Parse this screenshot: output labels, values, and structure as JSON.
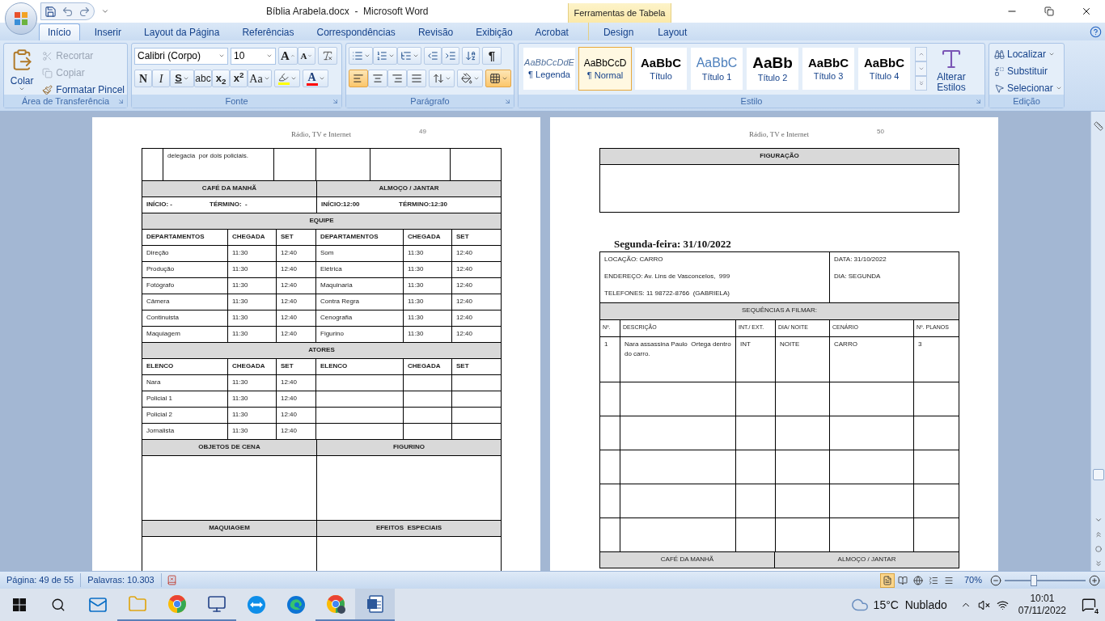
{
  "title_bar": {
    "title": "Bíblia Arabela.docx  -  Microsoft Word",
    "contextual_group": "Ferramentas de Tabela"
  },
  "quick_access": [
    {
      "kind": "save"
    },
    {
      "kind": "undo"
    },
    {
      "kind": "redo"
    },
    {
      "kind": "customize"
    }
  ],
  "tabs": [
    {
      "label": "Início",
      "selected": true
    },
    {
      "label": "Inserir",
      "selected": false
    },
    {
      "label": "Layout da Página",
      "selected": false
    },
    {
      "label": "Referências",
      "selected": false
    },
    {
      "label": "Correspondências",
      "selected": false
    },
    {
      "label": "Revisão",
      "selected": false
    },
    {
      "label": "Exibição",
      "selected": false
    },
    {
      "label": "Acrobat",
      "selected": false
    }
  ],
  "contextual_tabs": [
    {
      "label": "Design",
      "selected": false
    },
    {
      "label": "Layout",
      "selected": false
    }
  ],
  "ribbon": {
    "clipboard": {
      "label": "Área de Transferência",
      "paste": "Colar",
      "items": [
        {
          "kind": "cut",
          "label": "Recortar",
          "disabled": true
        },
        {
          "kind": "copy",
          "label": "Copiar",
          "disabled": true
        },
        {
          "kind": "painter",
          "label": "Formatar Pincel",
          "disabled": false
        }
      ]
    },
    "font": {
      "label": "Fonte",
      "font_name": "Calibri (Corpo)",
      "font_size": "10",
      "grow_font": "A",
      "shrink_font": "A",
      "format_buttons": [
        {
          "kind": "bold",
          "label": "N",
          "dropdown": false
        },
        {
          "kind": "italic",
          "label": "I",
          "dropdown": false
        },
        {
          "kind": "underline",
          "label": "S",
          "dropdown": true
        },
        {
          "kind": "strike",
          "label": "abc",
          "dropdown": false
        },
        {
          "kind": "subscript",
          "label": "x$_{2}$",
          "dropdown": false
        },
        {
          "kind": "superscript",
          "label": "x$^{2}$",
          "dropdown": false
        },
        {
          "kind": "case",
          "label": "Aa",
          "dropdown": true
        }
      ],
      "font_color": "A"
    },
    "paragraph": {
      "label": "Parágrafo",
      "show_marks": "¶",
      "alignments": [
        {
          "kind": "left",
          "selected": true
        },
        {
          "kind": "center",
          "selected": false
        },
        {
          "kind": "right",
          "selected": false
        },
        {
          "kind": "justify",
          "selected": false
        }
      ],
      "fill_buttons": [
        {
          "kind": "line_spacing",
          "selected": false
        },
        {
          "kind": "shading",
          "selected": false
        },
        {
          "kind": "borders",
          "selected": true
        }
      ]
    },
    "styles": {
      "label": "Estilo",
      "change_styles": "Alterar Estilos",
      "items": [
        {
          "kind": "caption",
          "preview": "AaBbCcDdE",
          "name": "¶ Legenda",
          "selected": false
        },
        {
          "kind": "normal",
          "preview": "AaBbCcD",
          "name": "¶ Normal",
          "selected": true
        },
        {
          "kind": "title",
          "preview": "AaBbC",
          "name": "Título",
          "selected": false
        },
        {
          "kind": "heading1",
          "preview": "AaBbC",
          "name": "Título 1",
          "selected": false
        },
        {
          "kind": "heading2",
          "preview": "AaBb",
          "name": "Título 2",
          "selected": false
        },
        {
          "kind": "heading3",
          "preview": "AaBbC",
          "name": "Título 3",
          "selected": false
        },
        {
          "kind": "heading4",
          "preview": "AaBbC",
          "name": "Título 4",
          "selected": false
        }
      ]
    },
    "editing": {
      "label": "Edição",
      "items": [
        {
          "kind": "find",
          "label": "Localizar",
          "dropdown": true
        },
        {
          "kind": "replace",
          "label": "Substituir",
          "dropdown": false
        },
        {
          "kind": "select",
          "label": "Selecionar",
          "dropdown": true
        }
      ]
    }
  },
  "pages": [
    {
      "header": "Rádio, TV e Internet",
      "number": "49",
      "blocks": [
        {
          "kind": "table",
          "rows": [
            {
              "kind": "continuation",
              "cells": [
                "delegacia  por dois policiais."
              ]
            },
            {
              "kind": "pair_head",
              "cells": [
                "CAFÉ DA MANHÃ",
                "ALMOÇO / JANTAR"
              ]
            },
            {
              "kind": "times",
              "cells": [
                {
                  "start": "INÍCIO: -",
                  "end": "TÉRMINO:  -"
                },
                {
                  "start": "INÍCIO:12:00",
                  "end": "TÉRMINO:12:30"
                }
              ]
            },
            {
              "kind": "band",
              "cells": [
                "EQUIPE"
              ]
            },
            {
              "kind": "crew_head",
              "cells": [
                "DEPARTAMENTOS",
                "CHEGADA",
                "SET",
                "DEPARTAMENTOS",
                "CHEGADA",
                "SET"
              ]
            },
            {
              "kind": "crew",
              "cells": [
                "Direção",
                "11:30",
                "12:40",
                "Som",
                "11:30",
                "12:40"
              ]
            },
            {
              "kind": "crew",
              "cells": [
                "Produção",
                "11:30",
                "12:40",
                "Elétrica",
                "11:30",
                "12:40"
              ]
            },
            {
              "kind": "crew",
              "cells": [
                "Fotógrafo",
                "11:30",
                "12:40",
                "Maquinaria",
                "11:30",
                "12:40"
              ]
            },
            {
              "kind": "crew",
              "cells": [
                "Câmera",
                "11:30",
                "12:40",
                "Contra Regra",
                "11:30",
                "12:40"
              ]
            },
            {
              "kind": "crew",
              "cells": [
                "Continuista",
                "11:30",
                "12:40",
                "Cenografia",
                "11:30",
                "12:40"
              ]
            },
            {
              "kind": "crew",
              "cells": [
                "Maquiagem",
                "11:30",
                "12:40",
                "Figurino",
                "11:30",
                "12:40"
              ]
            },
            {
              "kind": "band",
              "cells": [
                "ATORES"
              ]
            },
            {
              "kind": "crew_head",
              "cells": [
                "ELENCO",
                "CHEGADA",
                "SET",
                "ELENCO",
                "CHEGADA",
                "SET"
              ]
            },
            {
              "kind": "crew",
              "cells": [
                "Nara",
                "11:30",
                "12:40"
              ]
            },
            {
              "kind": "crew",
              "cells": [
                "Policial 1",
                "11:30",
                "12:40"
              ]
            },
            {
              "kind": "crew",
              "cells": [
                "Policial 2",
                "11:30",
                "12:40"
              ]
            },
            {
              "kind": "crew",
              "cells": [
                "Jornalista",
                "11:30",
                "12:40"
              ]
            },
            {
              "kind": "pair_head",
              "cells": [
                "OBJETOS DE CENA",
                "FIGURINO"
              ]
            },
            {
              "kind": "pair_box"
            },
            {
              "kind": "pair_head",
              "cells": [
                "MAQUIAGEM",
                "EFEITOS  ESPECIAIS"
              ]
            },
            {
              "kind": "pair_box"
            }
          ]
        }
      ]
    },
    {
      "header": "Rádio, TV e Internet",
      "number": "50",
      "blocks": [
        {
          "kind": "table",
          "rows": [
            {
              "kind": "band",
              "cells": [
                "FIGURAÇÃO"
              ]
            },
            {
              "kind": "box"
            }
          ]
        },
        {
          "kind": "heading",
          "text": "Segunda-feira: 31/10/2022"
        },
        {
          "kind": "table",
          "rows": [
            {
              "kind": "info",
              "cells": [
                [
                  "LOCAÇÃO: CARRO",
                  "ENDEREÇO: Av. Lins de Vasconcelos,  999",
                  "TELEFONES: 11 98722-8766  (GABRIELA)"
                ],
                [
                  "DATA: 31/10/2022",
                  "DIA: SEGUNDA"
                ]
              ]
            },
            {
              "kind": "band_plain",
              "cells": [
                "SEQUÊNCIAS A FILMAR:"
              ]
            },
            {
              "kind": "scene_head",
              "cells": [
                "Nº.",
                "DESCRIÇÃO",
                "INT./ EXT.",
                "DIA/ NOITE",
                "CENÁRIO",
                "Nº. PLANOS"
              ]
            },
            {
              "kind": "scene",
              "cells": [
                "1",
                "Nara assassina Paulo  Ortega dentro do carro.",
                "INT",
                "NOITE",
                "CARRO",
                "3"
              ]
            },
            {
              "kind": "scene_blank"
            },
            {
              "kind": "scene_blank"
            },
            {
              "kind": "scene_blank"
            },
            {
              "kind": "scene_blank"
            },
            {
              "kind": "scene_blank"
            },
            {
              "kind": "pair_head_plain",
              "cells": [
                "CAFÉ DA MANHÃ",
                "ALMOÇO / JANTAR"
              ]
            }
          ]
        }
      ]
    }
  ],
  "status_bar": {
    "page": "Página: 49 de 55",
    "words": "Palavras: 10.303",
    "views": [
      {
        "kind": "print",
        "selected": true
      },
      {
        "kind": "reading",
        "selected": false
      },
      {
        "kind": "web",
        "selected": false
      },
      {
        "kind": "outline",
        "selected": false
      },
      {
        "kind": "draft",
        "selected": false
      }
    ],
    "zoom": "70%",
    "zoom_slider": {
      "level": 0.36
    }
  },
  "taskbar": {
    "apps": [
      {
        "kind": "mail",
        "running": false,
        "selected": false
      },
      {
        "kind": "folder",
        "running": true,
        "selected": false
      },
      {
        "kind": "chrome",
        "running": true,
        "selected": false
      },
      {
        "kind": "remote",
        "running": true,
        "selected": false
      },
      {
        "kind": "teamviewer",
        "running": false,
        "selected": false
      },
      {
        "kind": "edge",
        "running": false,
        "selected": false
      },
      {
        "kind": "chrome_profile",
        "running": true,
        "selected": false
      },
      {
        "kind": "word",
        "running": true,
        "selected": true
      }
    ],
    "weather": "15°C  Nublado",
    "time": "10:01",
    "date": "07/11/2022",
    "notifications": "4"
  }
}
